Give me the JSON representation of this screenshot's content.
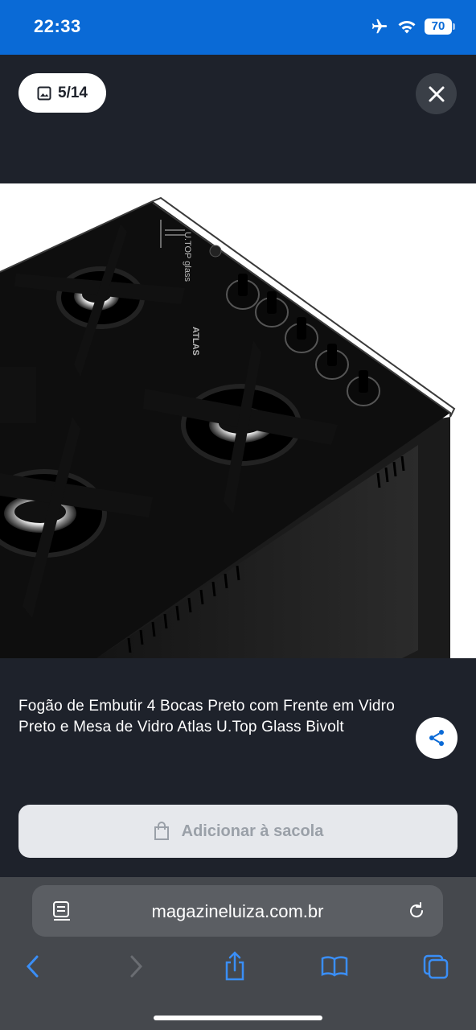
{
  "status_bar": {
    "time": "22:33",
    "battery": "70",
    "icons": [
      "airplane-icon",
      "wifi-icon",
      "battery-icon"
    ]
  },
  "gallery": {
    "counter": "5/14",
    "close_icon": "close-icon",
    "image_brand_text": "ATLAS",
    "image_model_text": "U.TOP glass"
  },
  "product": {
    "title": "Fogão de Embutir 4 Bocas Preto com Frente em Vidro Preto e Mesa de Vidro Atlas U.Top Glass Bivolt",
    "share_icon": "share-icon"
  },
  "cart": {
    "add_label": "Adicionar à sacola",
    "icon": "shopping-bag-icon"
  },
  "browser": {
    "url": "magazineluiza.com.br",
    "nav_icons": [
      "back-icon",
      "forward-icon",
      "share-icon",
      "bookmarks-icon",
      "tabs-icon"
    ]
  },
  "colors": {
    "status_bar": "#0a6ad6",
    "background": "#1e222b",
    "browser_bar": "#45484d",
    "accent_icon": "#3a8ef6",
    "add_button": "#e6e8ec"
  }
}
